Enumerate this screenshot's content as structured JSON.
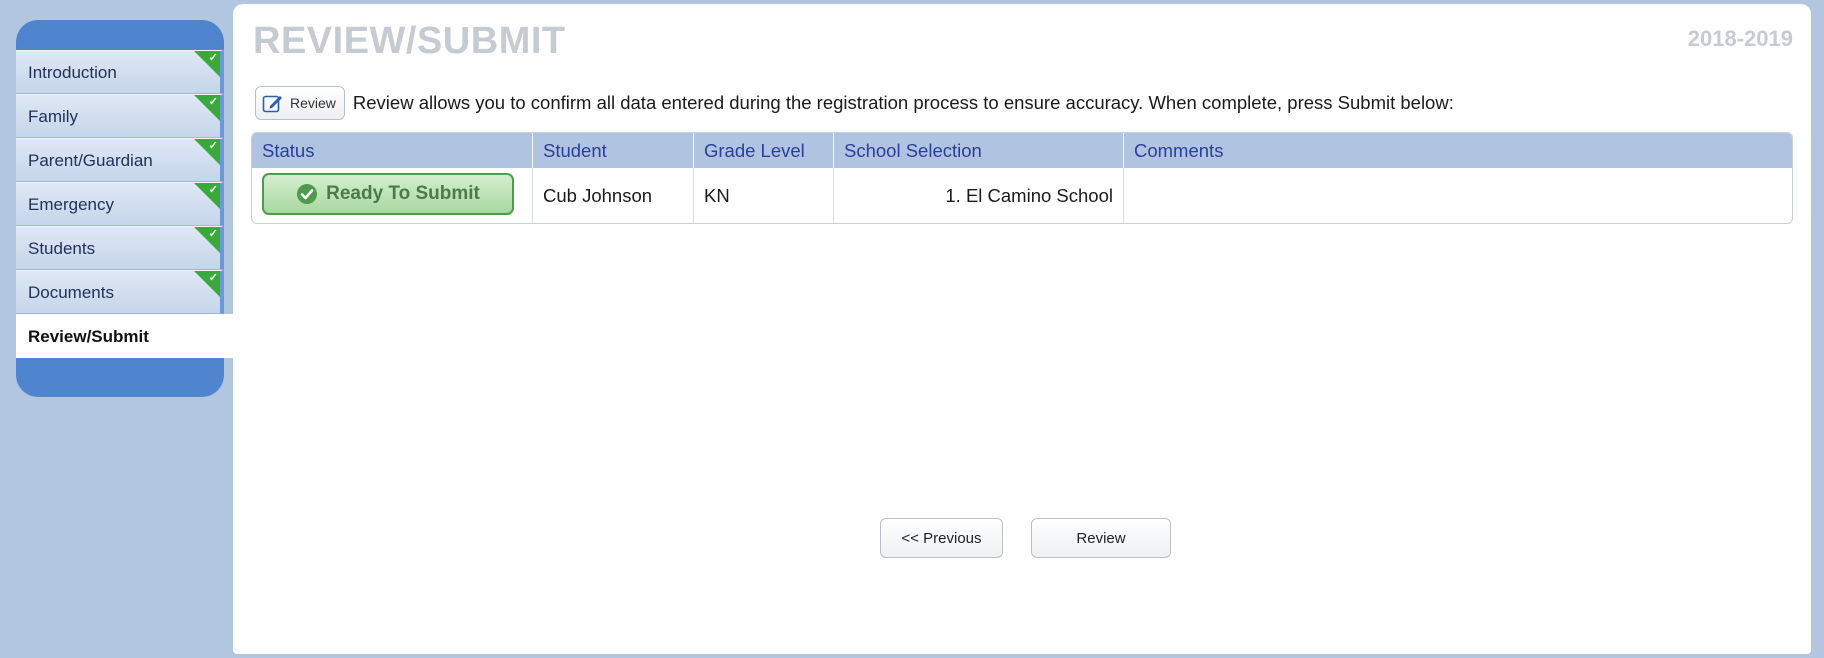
{
  "sidebar": {
    "items": [
      {
        "label": "Introduction",
        "completed": true,
        "active": false
      },
      {
        "label": "Family",
        "completed": true,
        "active": false
      },
      {
        "label": "Parent/Guardian",
        "completed": true,
        "active": false
      },
      {
        "label": "Emergency",
        "completed": true,
        "active": false
      },
      {
        "label": "Students",
        "completed": true,
        "active": false
      },
      {
        "label": "Documents",
        "completed": true,
        "active": false
      },
      {
        "label": "Review/Submit",
        "completed": false,
        "active": true
      }
    ]
  },
  "header": {
    "title": "REVIEW/SUBMIT",
    "school_year": "2018-2019"
  },
  "instruction": {
    "button_label": "Review",
    "text": "Review allows you to confirm all data entered during the registration process to ensure accuracy. When complete, press Submit below:"
  },
  "table": {
    "headers": [
      "Status",
      "Student",
      "Grade Level",
      "School Selection",
      "Comments"
    ],
    "rows": [
      {
        "status": "Ready To Submit",
        "student": "Cub Johnson",
        "grade": "KN",
        "school": "1. El Camino School",
        "comments": ""
      }
    ]
  },
  "footer": {
    "previous_label": "<< Previous",
    "review_label": "Review"
  },
  "colors": {
    "sidebar_blue": "#4f85cf",
    "complete_green": "#38a93a",
    "header_row": "#b0c4e1",
    "title_gray": "#c5cbd3"
  },
  "icons": {
    "review_button": "pencil-edit-icon",
    "status": "check-circle-icon",
    "nav_complete": "checkmark-corner-icon"
  }
}
